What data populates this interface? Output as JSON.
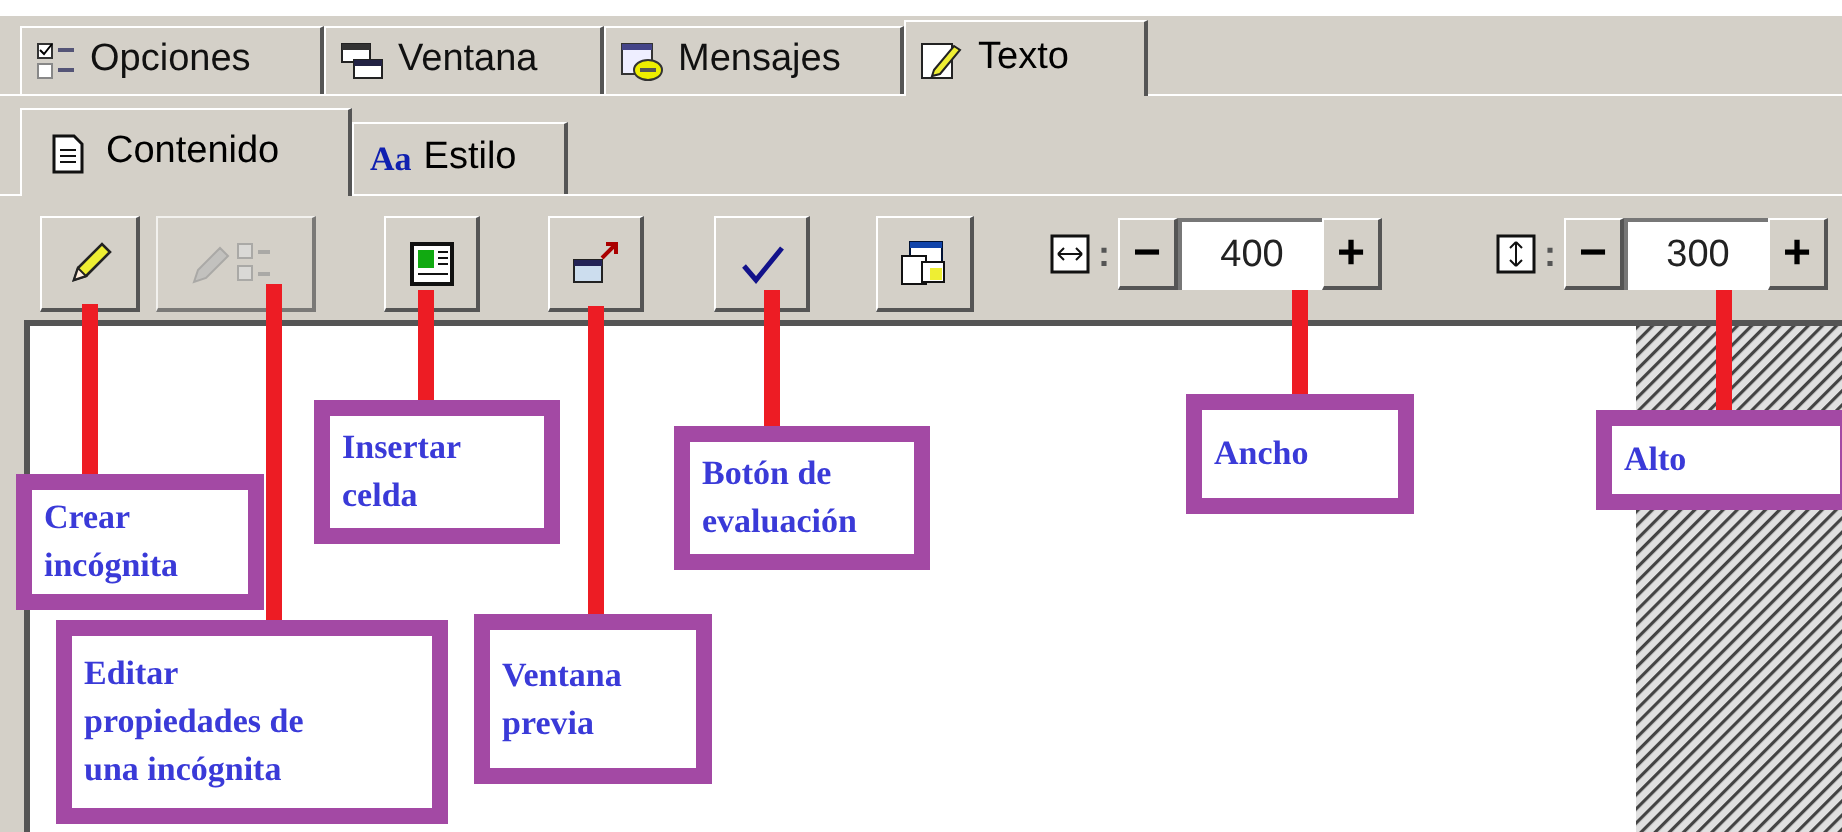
{
  "tabs": [
    {
      "label": "Opciones",
      "selected": false
    },
    {
      "label": "Ventana",
      "selected": false
    },
    {
      "label": "Mensajes",
      "selected": false
    },
    {
      "label": "Texto",
      "selected": true
    }
  ],
  "subtabs": [
    {
      "label": "Contenido",
      "selected": true
    },
    {
      "glyph": "Aa",
      "label": "Estilo",
      "selected": false
    }
  ],
  "toolbar": [
    {
      "disabled": false
    },
    {
      "disabled": true
    },
    {
      "disabled": false
    },
    {
      "disabled": false
    },
    {
      "disabled": false
    },
    {
      "disabled": false
    }
  ],
  "size": [
    {
      "kind": "width",
      "separator": ":",
      "minus": "−",
      "value": "400",
      "plus": "+"
    },
    {
      "kind": "height",
      "separator": ":",
      "minus": "−",
      "value": "300",
      "plus": "+"
    }
  ],
  "callouts": [
    {
      "text": "Insertar celda"
    },
    {
      "text": "Botón de evaluación"
    },
    {
      "text": "Ancho"
    },
    {
      "text": "Alto"
    },
    {
      "text": "Crear incógnita"
    },
    {
      "text": "Editar propiedades de una incógnita"
    },
    {
      "text": "Ventana previa"
    }
  ]
}
